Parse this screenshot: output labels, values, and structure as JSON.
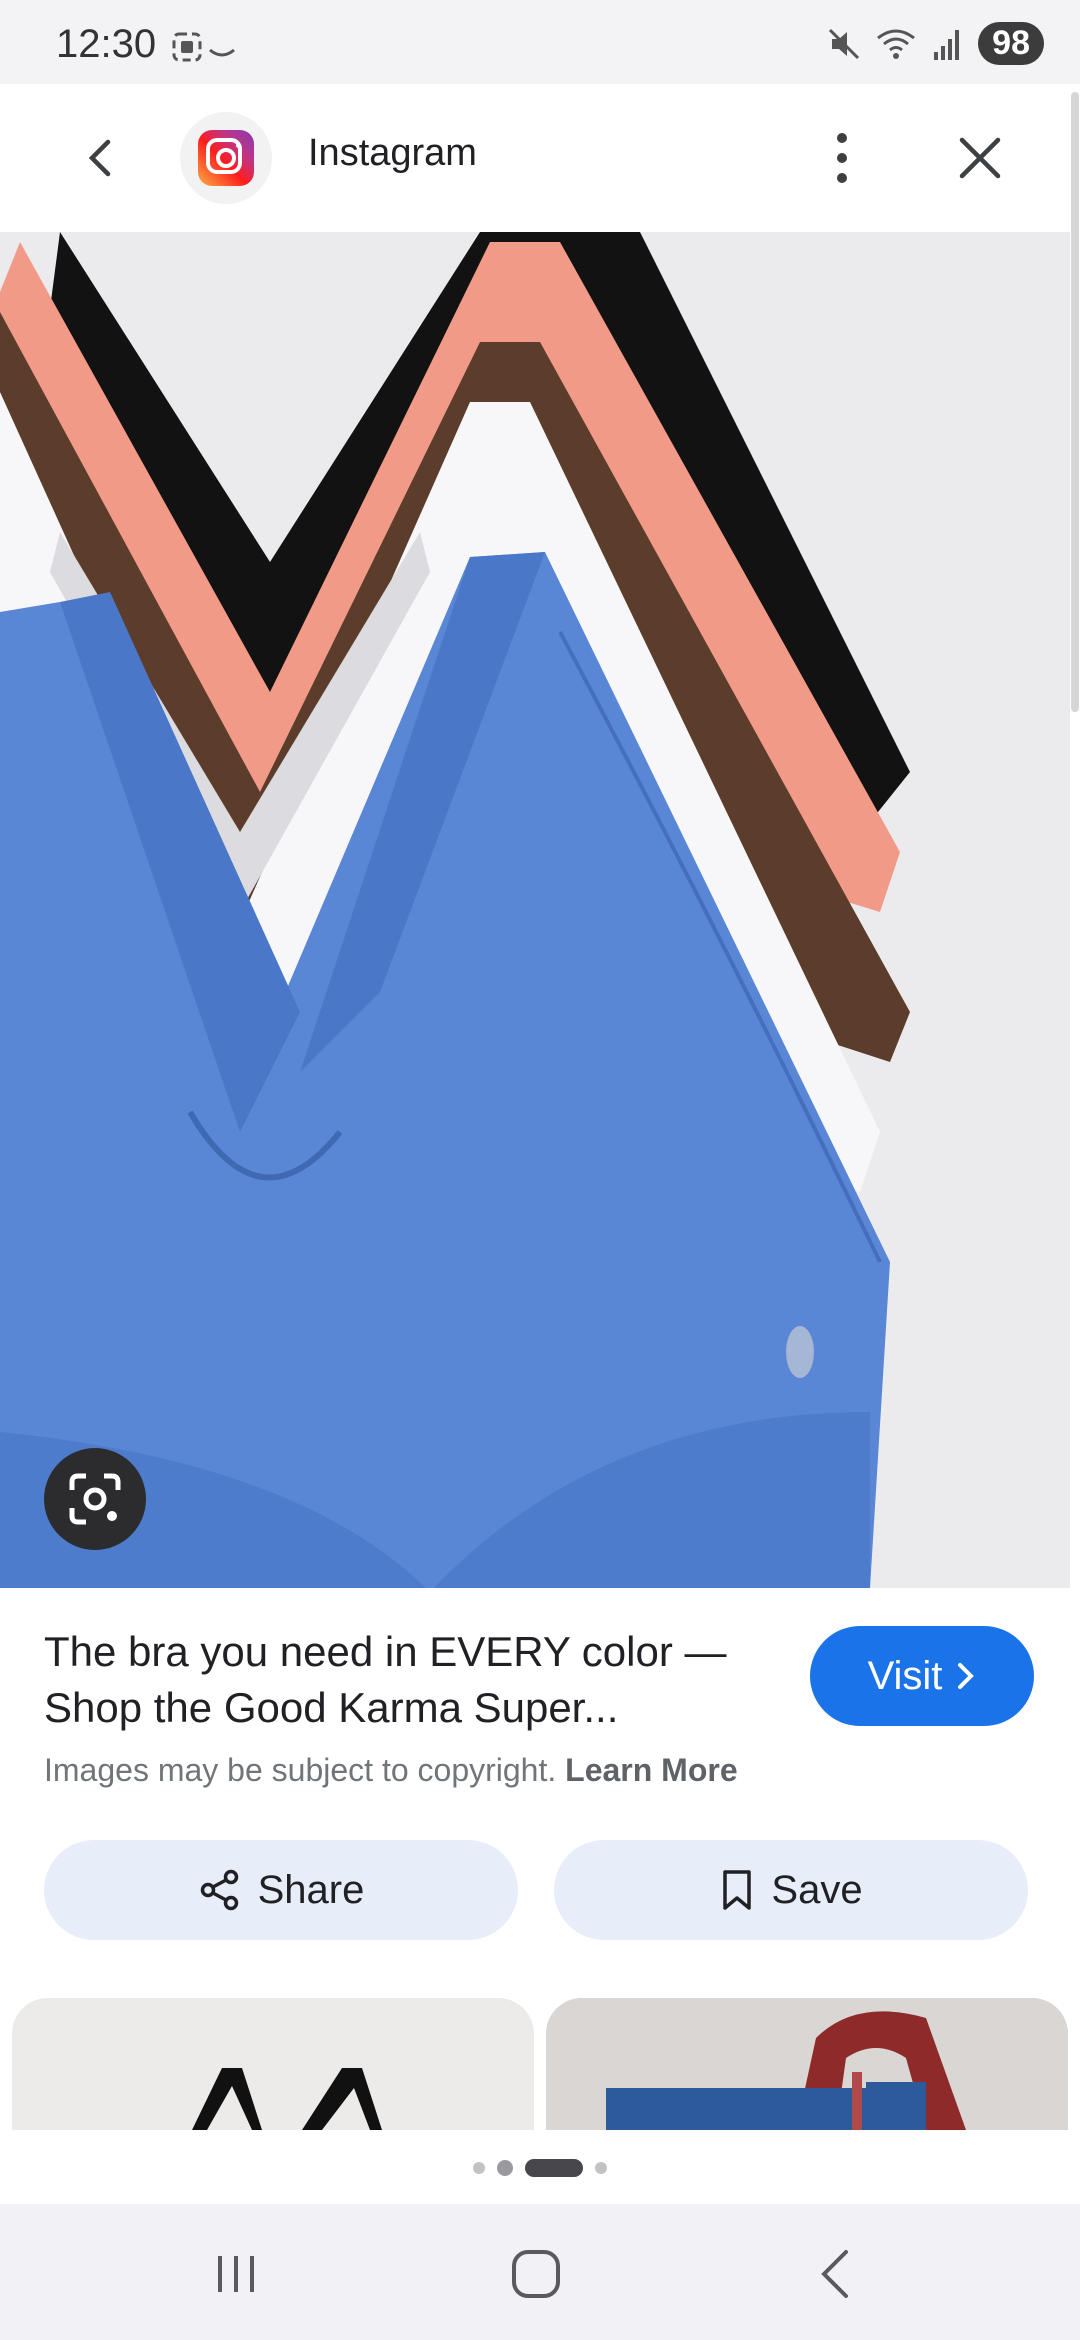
{
  "status_bar": {
    "time": "12:30",
    "battery": "98",
    "network": "6"
  },
  "header": {
    "app_name": "Instagram",
    "back_icon": "chevron-left-icon",
    "more_icon": "more-vert-icon",
    "close_icon": "close-icon"
  },
  "hero_image": {
    "description_icon": "product-photo",
    "lens_icon": "lens-camera-icon"
  },
  "result": {
    "caption": "The bra you need in EVERY color — Shop the Good Karma Super...",
    "copyright_text": "Images may be subject to copyright.",
    "learn_more": "Learn More",
    "visit_label": "Visit"
  },
  "actions": {
    "share_label": "Share",
    "save_label": "Save"
  },
  "pager": {
    "active_index": 2,
    "count": 4
  },
  "colors": {
    "accent": "#1a73e8",
    "pill_bg": "#e8eef9"
  }
}
